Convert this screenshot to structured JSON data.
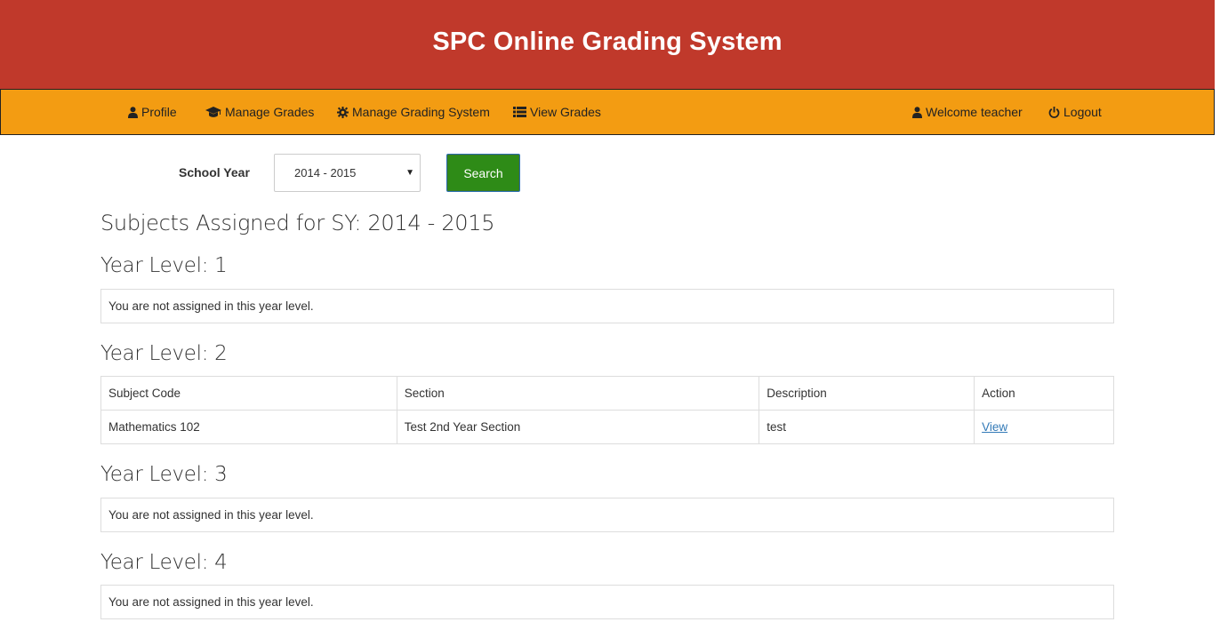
{
  "header": {
    "title": "SPC Online Grading System"
  },
  "nav": {
    "profile": "Profile",
    "manage_grades": "Manage Grades",
    "manage_grading_system": "Manage Grading System",
    "view_grades": "View Grades",
    "welcome": "Welcome teacher",
    "logout": "Logout"
  },
  "filter": {
    "label": "School Year",
    "selected": "2014 - 2015",
    "search_label": "Search"
  },
  "page_title": "Subjects Assigned for SY: 2014 - 2015",
  "levels": [
    {
      "title": "Year Level: 1",
      "notice": "You are not assigned in this year level."
    },
    {
      "title": "Year Level: 2"
    },
    {
      "title": "Year Level: 3",
      "notice": "You are not assigned in this year level."
    },
    {
      "title": "Year Level: 4",
      "notice": "You are not assigned in this year level."
    }
  ],
  "table": {
    "headers": [
      "Subject Code",
      "Section",
      "Description",
      "Action"
    ],
    "rows": [
      {
        "subject_code": "Mathematics 102",
        "section": "Test 2nd Year Section",
        "description": "test",
        "action": "View"
      }
    ]
  },
  "colors": {
    "header_bg": "#c0392b",
    "navbar_bg": "#f39c12",
    "search_btn": "#2e8b17",
    "link": "#337ab7"
  }
}
